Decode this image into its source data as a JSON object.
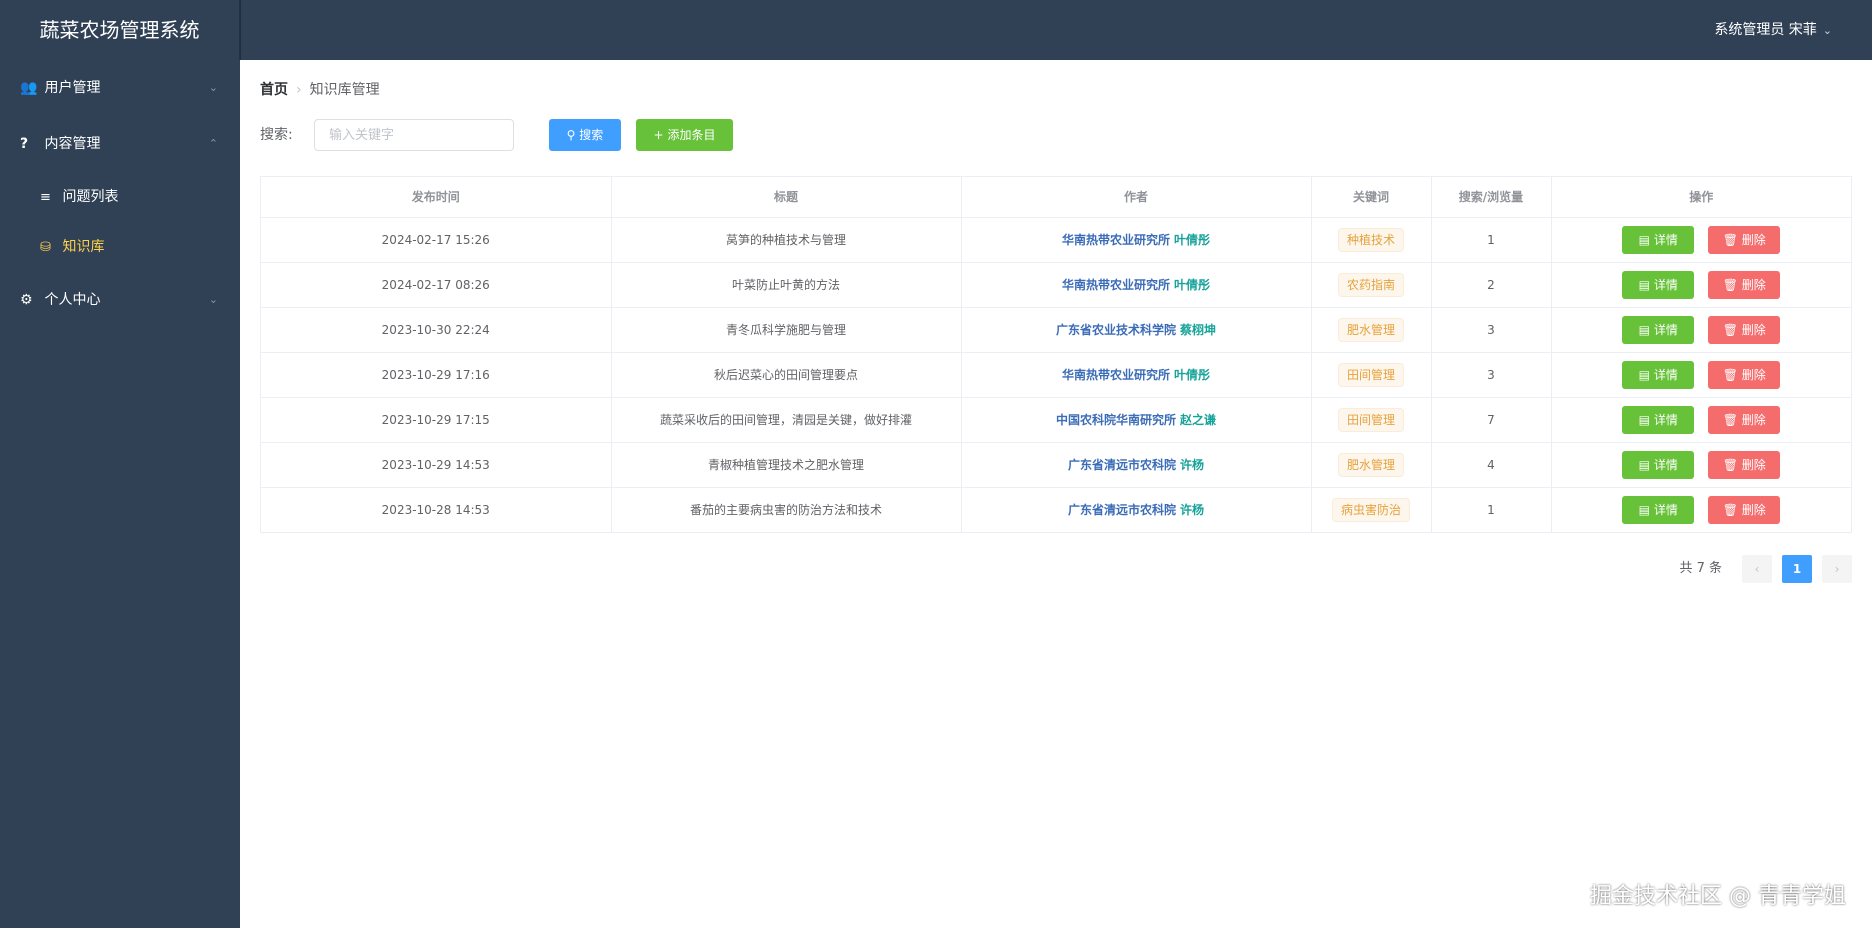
{
  "app": {
    "title": "蔬菜农场管理系统"
  },
  "header": {
    "user": "系统管理员 宋菲"
  },
  "sidebar": {
    "items": [
      {
        "label": "用户管理"
      },
      {
        "label": "内容管理",
        "children": [
          {
            "label": "问题列表"
          },
          {
            "label": "知识库"
          }
        ]
      },
      {
        "label": "个人中心"
      }
    ]
  },
  "breadcrumb": {
    "home": "首页",
    "current": "知识库管理"
  },
  "search": {
    "label": "搜索:",
    "placeholder": "输入关键字",
    "search_button": "搜索",
    "add_button": "添加条目"
  },
  "table": {
    "headers": [
      "发布时间",
      "标题",
      "作者",
      "关键词",
      "搜索/浏览量",
      "操作"
    ],
    "detail_label": "详情",
    "delete_label": "删除",
    "rows": [
      {
        "time": "2024-02-17 15:26",
        "title": "莴笋的种植技术与管理",
        "org": "华南热带农业研究所",
        "author": "叶倩彤",
        "keyword": "种植技术",
        "views": "1"
      },
      {
        "time": "2024-02-17 08:26",
        "title": "叶菜防止叶黄的方法",
        "org": "华南热带农业研究所",
        "author": "叶倩彤",
        "keyword": "农药指南",
        "views": "2"
      },
      {
        "time": "2023-10-30 22:24",
        "title": "青冬瓜科学施肥与管理",
        "org": "广东省农业技术科学院",
        "author": "蔡栩坤",
        "keyword": "肥水管理",
        "views": "3"
      },
      {
        "time": "2023-10-29 17:16",
        "title": "秋后迟菜心的田间管理要点",
        "org": "华南热带农业研究所",
        "author": "叶倩彤",
        "keyword": "田间管理",
        "views": "3"
      },
      {
        "time": "2023-10-29 17:15",
        "title": "蔬菜采收后的田间管理，清园是关键，做好排灌",
        "org": "中国农科院华南研究所",
        "author": "赵之谦",
        "keyword": "田间管理",
        "views": "7"
      },
      {
        "time": "2023-10-29 14:53",
        "title": "青椒种植管理技术之肥水管理",
        "org": "广东省清远市农科院",
        "author": "许杨",
        "keyword": "肥水管理",
        "views": "4"
      },
      {
        "time": "2023-10-28 14:53",
        "title": "番茄的主要病虫害的防治方法和技术",
        "org": "广东省清远市农科院",
        "author": "许杨",
        "keyword": "病虫害防治",
        "views": "1"
      }
    ]
  },
  "pagination": {
    "total": "共 7 条",
    "current": "1"
  },
  "watermark": "掘金技术社区 @ 青青学姐"
}
